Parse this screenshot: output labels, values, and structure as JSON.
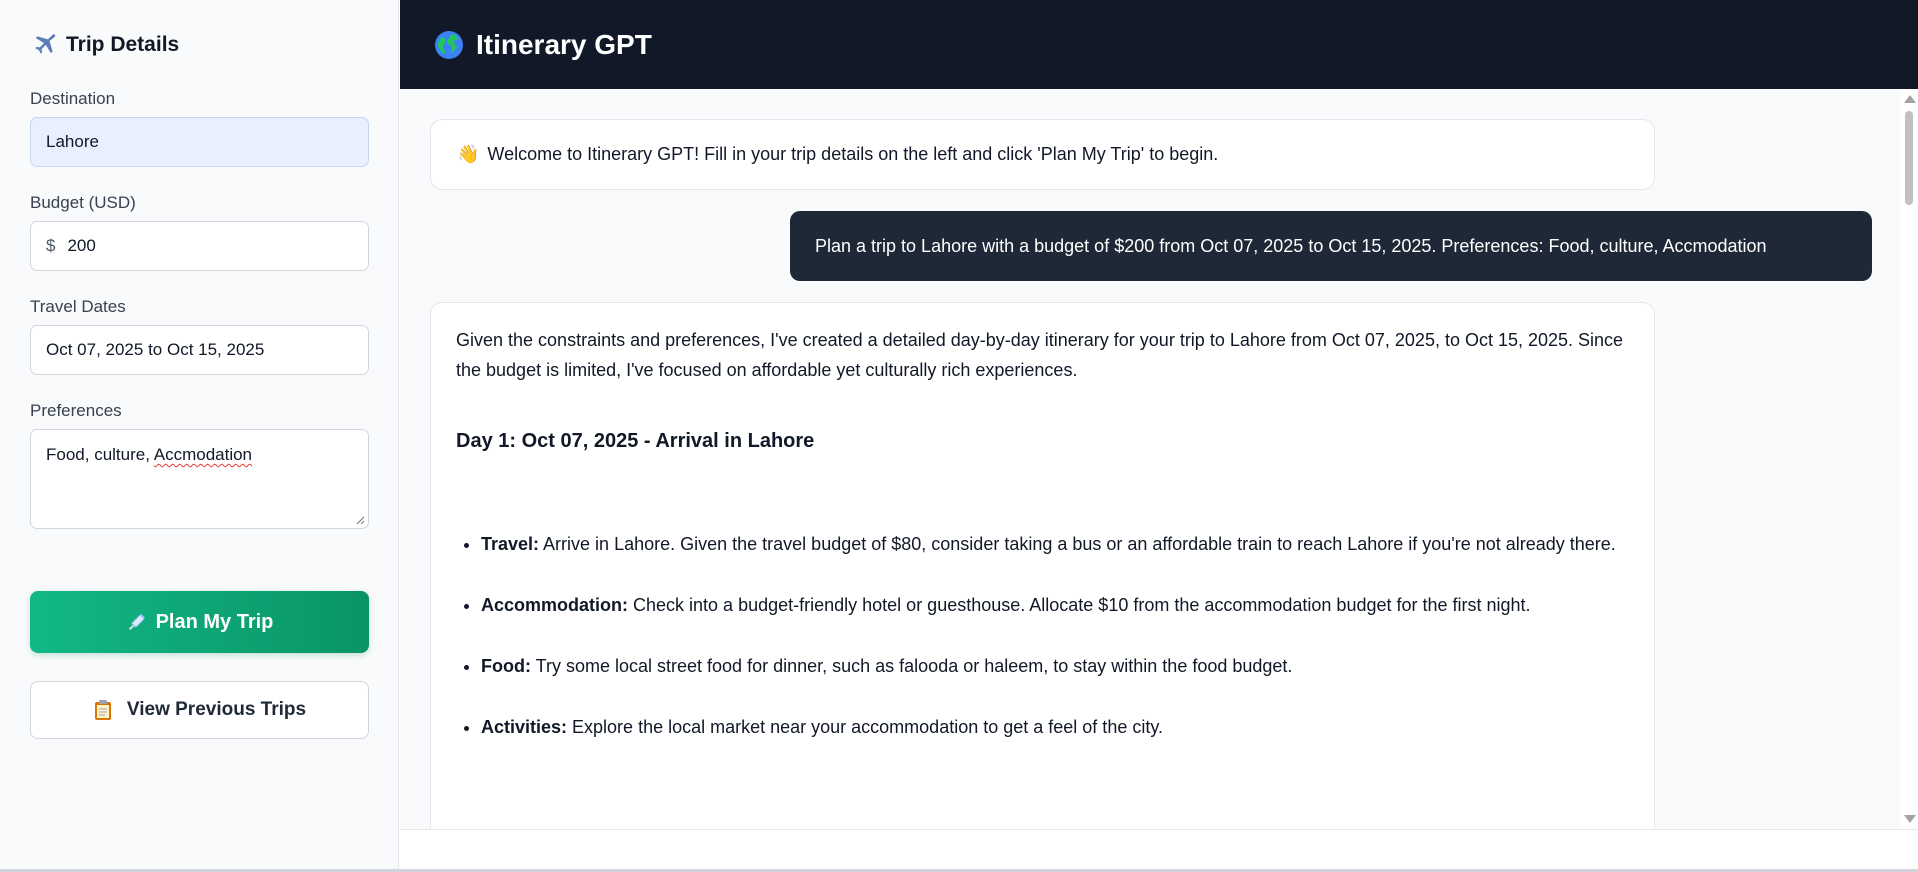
{
  "sidebar": {
    "title": "Trip Details",
    "title_icon": "airplane-icon",
    "destination": {
      "label": "Destination",
      "value": "Lahore"
    },
    "budget": {
      "label": "Budget (USD)",
      "prefix": "$",
      "value": "200"
    },
    "dates": {
      "label": "Travel Dates",
      "value": "Oct 07, 2025 to Oct 15, 2025"
    },
    "preferences": {
      "label": "Preferences",
      "value_start": "Food, culture, ",
      "value_misspelled": "Accmodation"
    },
    "plan_button": {
      "label": "Plan My Trip",
      "icon": "syringe-icon"
    },
    "history_button": {
      "label": "View Previous Trips",
      "icon": "clipboard-icon"
    }
  },
  "header": {
    "title": "Itinerary GPT",
    "icon": "globe-icon"
  },
  "chat": {
    "welcome": {
      "emoji": "👋",
      "text": "Welcome to Itinerary GPT! Fill in your trip details on the left and click 'Plan My Trip' to begin."
    },
    "user_message": "Plan a trip to Lahore with a budget of $200 from Oct 07, 2025 to Oct 15, 2025. Preferences: Food, culture, Accmodation",
    "reply": {
      "intro": "Given the constraints and preferences, I've created a detailed day-by-day itinerary for your trip to Lahore from Oct 07, 2025, to Oct 15, 2025. Since the budget is limited, I've focused on affordable yet culturally rich experiences.",
      "day_heading": "Day 1: Oct 07, 2025 - Arrival in Lahore",
      "items": [
        {
          "label": "Travel:",
          "text": " Arrive in Lahore. Given the travel budget of $80, consider taking a bus or an affordable train to reach Lahore if you're not already there."
        },
        {
          "label": "Accommodation:",
          "text": " Check into a budget-friendly hotel or guesthouse. Allocate $10 from the accommodation budget for the first night."
        },
        {
          "label": "Food:",
          "text": " Try some local street food for dinner, such as falooda or haleem, to stay within the food budget."
        },
        {
          "label": "Activities:",
          "text": " Explore the local market near your accommodation to get a feel of the city."
        }
      ]
    }
  },
  "colors": {
    "header_bg": "#111827",
    "user_bubble": "#1e2836",
    "primary_green": "#12b886",
    "sidebar_bg": "#f9fafb"
  }
}
